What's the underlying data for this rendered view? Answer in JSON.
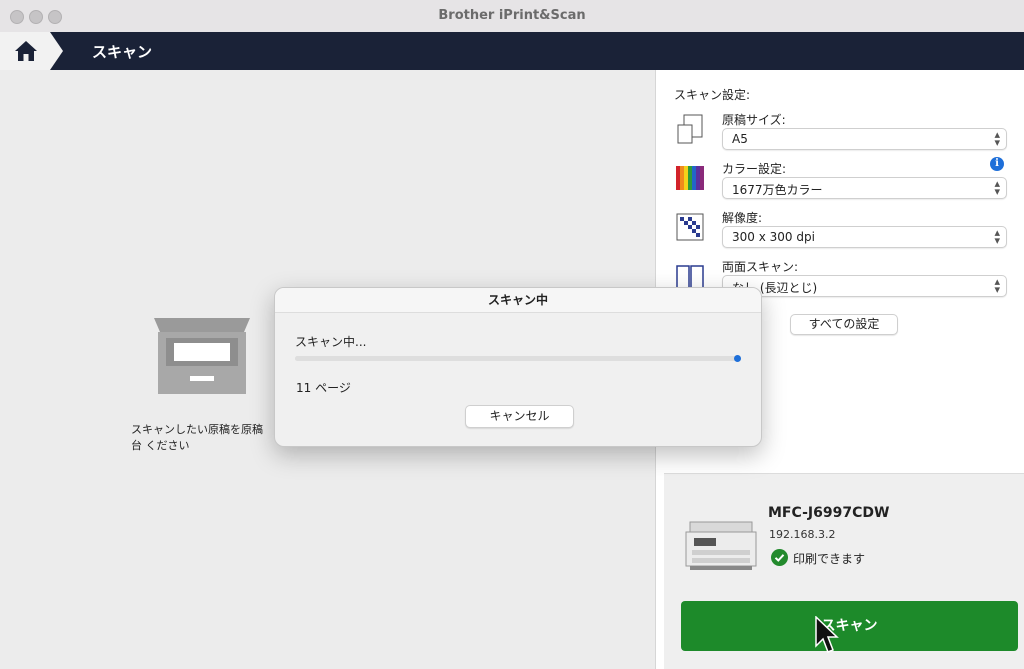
{
  "window": {
    "title": "Brother iPrint&Scan"
  },
  "nav": {
    "title": "スキャン",
    "home_icon": "home-icon"
  },
  "preview": {
    "instruction": "スキャンしたい原稿を原稿台 ください"
  },
  "settings": {
    "header": "スキャン設定:",
    "items": [
      {
        "label": "原稿サイズ:",
        "value": "A5",
        "icon": "document-size-icon"
      },
      {
        "label": "カラー設定:",
        "value": "1677万色カラー",
        "icon": "color-bars-icon"
      },
      {
        "label": "解像度:",
        "value": "300 x 300 dpi",
        "icon": "resolution-icon"
      },
      {
        "label": "両面スキャン:",
        "value": "なし (長辺とじ)",
        "icon": "duplex-icon"
      }
    ],
    "all_settings_label": "すべての設定"
  },
  "printer": {
    "name": "MFC-J6997CDW",
    "ip": "192.168.3.2",
    "status": "印刷できます"
  },
  "scan_button": {
    "label": "スキャン"
  },
  "dialog": {
    "title": "スキャン中",
    "status": "スキャン中...",
    "progress_fraction": 1.0,
    "pages": "11 ページ",
    "cancel_label": "キャンセル"
  },
  "colors": {
    "nav_bg": "#1a2237",
    "scan_button": "#1d8a2a",
    "accent_blue": "#1e6fd9",
    "status_green": "#238a2d"
  }
}
